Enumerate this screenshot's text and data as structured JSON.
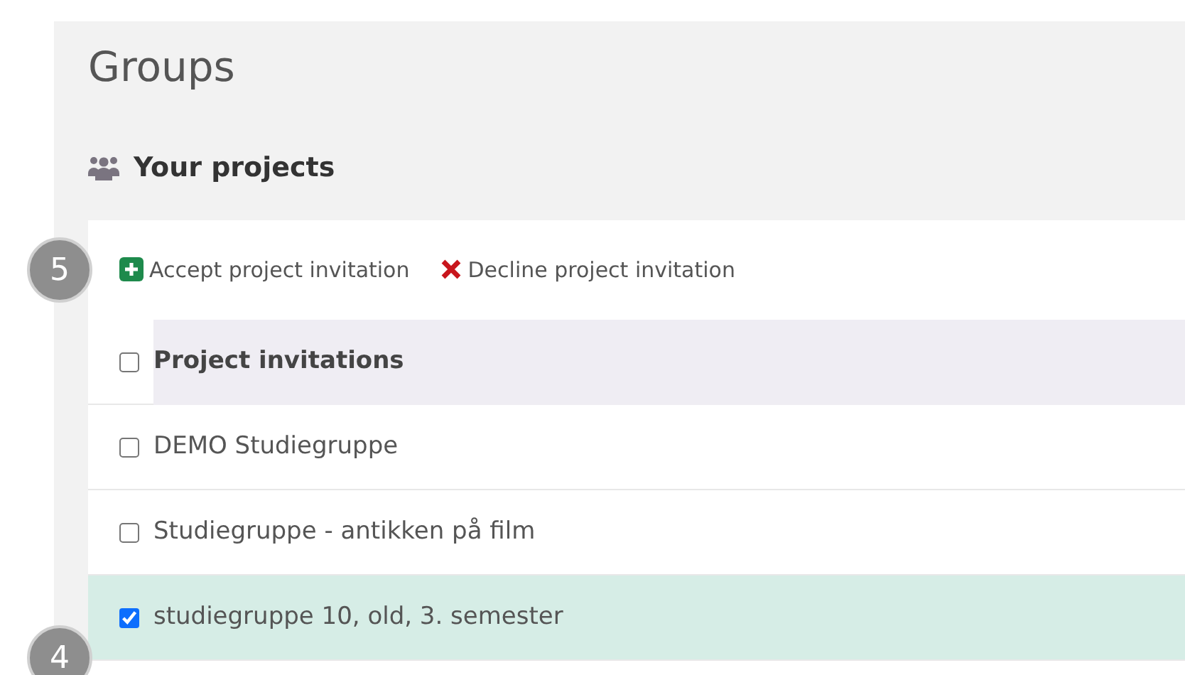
{
  "title": "Groups",
  "section": {
    "heading": "Your projects"
  },
  "actions": [
    {
      "kind": "accept",
      "label": "Accept project invitation"
    },
    {
      "kind": "decline",
      "label": "Decline project invitation"
    }
  ],
  "table": {
    "header": {
      "label": "Project invitations",
      "checked": false
    },
    "rows": [
      {
        "label": "DEMO Studiegruppe",
        "checked": false,
        "selected": false
      },
      {
        "label": "Studiegruppe - antikken på film",
        "checked": false,
        "selected": false
      },
      {
        "label": "studiegruppe 10, old, 3. semester",
        "checked": true,
        "selected": true
      }
    ]
  },
  "callouts": [
    {
      "label": "5"
    },
    {
      "label": "4"
    }
  ]
}
